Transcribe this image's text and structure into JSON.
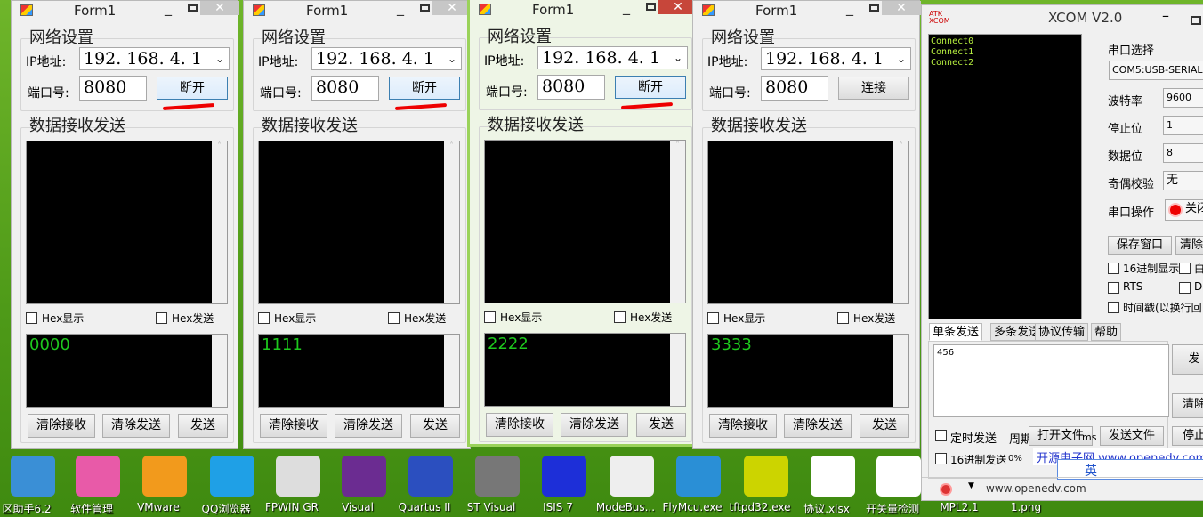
{
  "forms": [
    {
      "title": "Form1",
      "net_group": "网络设置",
      "ip_label": "IP地址:",
      "ip_value": "192. 168. 4. 1",
      "port_label": "端口号:",
      "port_value": "8080",
      "connect_button": "断开",
      "data_group": "数据接收发送",
      "hex_show": "Hex显示",
      "hex_send": "Hex发送",
      "send_text": "0000",
      "clear_recv": "清除接收",
      "clear_send": "清除发送",
      "send": "发送",
      "underlined": true,
      "active": false
    },
    {
      "title": "Form1",
      "net_group": "网络设置",
      "ip_label": "IP地址:",
      "ip_value": "192. 168. 4. 1",
      "port_label": "端口号:",
      "port_value": "8080",
      "connect_button": "断开",
      "data_group": "数据接收发送",
      "hex_show": "Hex显示",
      "hex_send": "Hex发送",
      "send_text": "1111",
      "clear_recv": "清除接收",
      "clear_send": "清除发送",
      "send": "发送",
      "underlined": true,
      "active": false
    },
    {
      "title": "Form1",
      "net_group": "网络设置",
      "ip_label": "IP地址:",
      "ip_value": "192. 168. 4. 1",
      "port_label": "端口号:",
      "port_value": "8080",
      "connect_button": "断开",
      "data_group": "数据接收发送",
      "hex_show": "Hex显示",
      "hex_send": "Hex发送",
      "send_text": "2222",
      "clear_recv": "清除接收",
      "clear_send": "清除发送",
      "send": "发送",
      "underlined": true,
      "active": true
    },
    {
      "title": "Form1",
      "net_group": "网络设置",
      "ip_label": "IP地址:",
      "ip_value": "192. 168. 4. 1",
      "port_label": "端口号:",
      "port_value": "8080",
      "connect_button": "连接",
      "data_group": "数据接收发送",
      "hex_show": "Hex显示",
      "hex_send": "Hex发送",
      "send_text": "3333",
      "clear_recv": "清除接收",
      "clear_send": "清除发送",
      "send": "发送",
      "underlined": false,
      "active": false
    }
  ],
  "xcom": {
    "logo": "ATK XCOM",
    "title": "XCOM V2.0",
    "recv_lines": [
      "Connect0",
      "Connect1",
      "Connect2"
    ],
    "port_select_label": "串口选择",
    "port_value": "COM5:USB-SERIAL",
    "baud_label": "波特率",
    "baud_value": "9600",
    "stop_label": "停止位",
    "stop_value": "1",
    "data_label": "数据位",
    "data_value": "8",
    "parity_label": "奇偶校验",
    "parity_value": "无",
    "op_label": "串口操作",
    "op_button": "关闭",
    "save_button": "保存窗口",
    "clear_button": "清除",
    "hex_display": "16进制显示",
    "auto": "白",
    "rts": "RTS",
    "dtr": "D",
    "timestamp": "时间戳(以换行回",
    "tabs": [
      "单条发送",
      "多条发送",
      "协议传输",
      "帮助"
    ],
    "send_text": "456",
    "send_button": "发",
    "clear_send_button": "清除",
    "timed_send": "定时发送",
    "period_label": "周期:",
    "open_file": "打开文件",
    "ms": "ms",
    "send_file": "发送文件",
    "stop": "停止",
    "hex_send": "16进制发送",
    "progress": "0%",
    "ad_text": "开源电子网 www.openedv.com",
    "status_url": "www.openedv.com",
    "ime": "英"
  },
  "desktop": [
    "区助手6.2",
    "软件管理",
    "VMware",
    "QQ浏览器",
    "FPWIN GR",
    "Visual",
    "Quartus II",
    "ST Visual",
    "ISIS 7",
    "ModeBus...",
    "FlyMcu.exe",
    "tftpd32.exe",
    "协议.xlsx",
    "开关量检测",
    "MPL2.1",
    "1.png"
  ],
  "colors": {
    "recv_text": "#1ec81e",
    "accent_active": "#9ad25a",
    "underline": "#e00000"
  }
}
